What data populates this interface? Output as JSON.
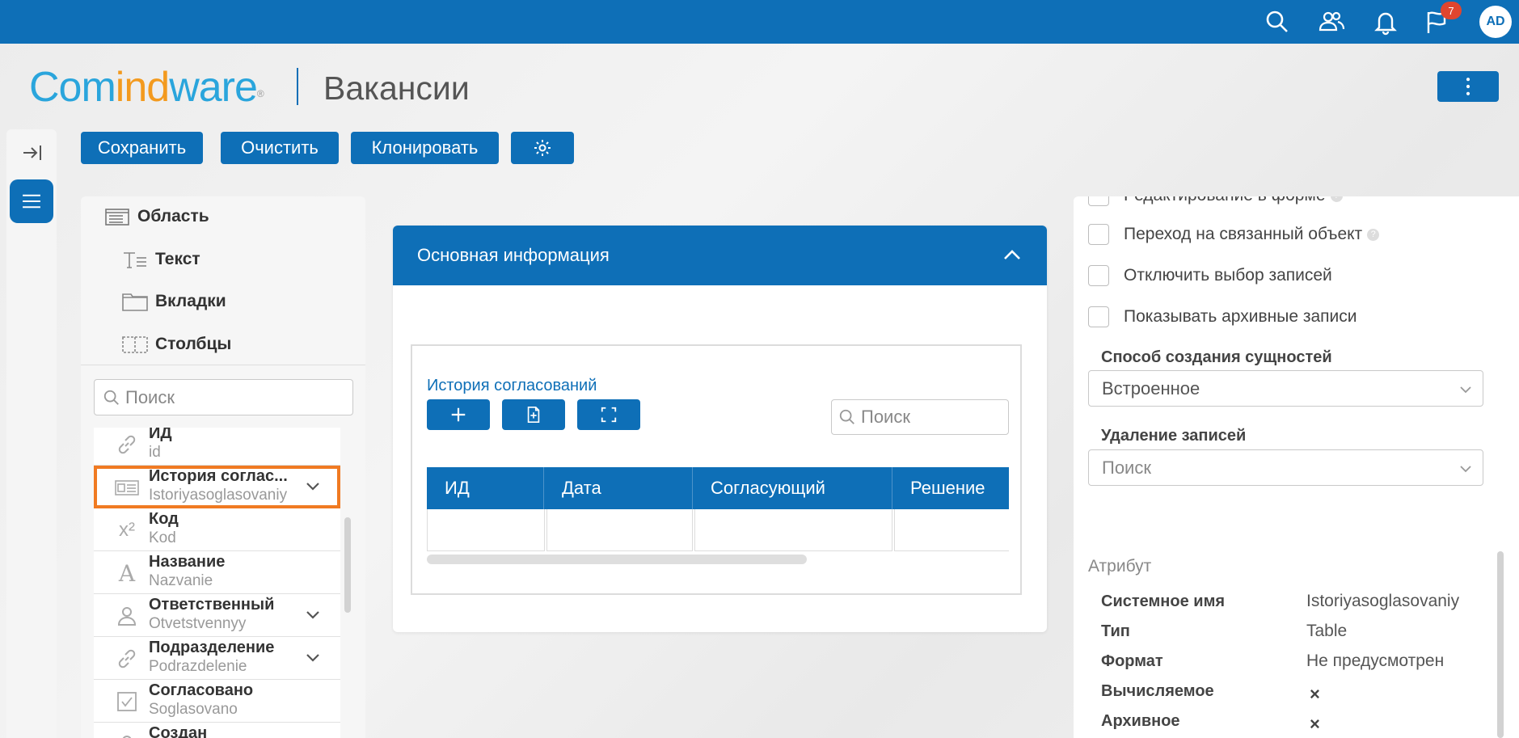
{
  "topbar": {
    "notification_count": "7",
    "avatar_initials": "AD",
    "icons": [
      "search-icon",
      "users-icon",
      "bell-icon",
      "flag-icon"
    ]
  },
  "header": {
    "logo_part1": "Com",
    "logo_part2": "ind",
    "logo_part3": "ware",
    "logo_reg": "®",
    "page_title": "Вакансии"
  },
  "toolbar": {
    "save_label": "Сохранить",
    "clear_label": "Очистить",
    "clone_label": "Клонировать"
  },
  "left_panel": {
    "elements": [
      {
        "label": "Область",
        "icon": "area-icon"
      },
      {
        "label": "Текст",
        "icon": "text-icon"
      },
      {
        "label": "Вкладки",
        "icon": "tabs-icon"
      },
      {
        "label": "Столбцы",
        "icon": "columns-icon"
      }
    ],
    "search_placeholder": "Поиск",
    "attributes": [
      {
        "name": "ИД",
        "system_name": "id",
        "icon": "link-icon",
        "expandable": false
      },
      {
        "name": "История соглас...",
        "system_name": "Istoriyasoglasovaniy",
        "icon": "table-icon",
        "expandable": true,
        "selected": true
      },
      {
        "name": "Код",
        "system_name": "Kod",
        "icon": "number-icon",
        "expandable": false
      },
      {
        "name": "Название",
        "system_name": "Nazvanie",
        "icon": "text-type-icon",
        "expandable": false
      },
      {
        "name": "Ответственный",
        "system_name": "Otvetstvennyy",
        "icon": "user-icon",
        "expandable": true
      },
      {
        "name": "Подразделение",
        "system_name": "Podrazdelenie",
        "icon": "link-icon",
        "expandable": true
      },
      {
        "name": "Согласовано",
        "system_name": "Soglasovano",
        "icon": "checkbox-icon",
        "expandable": false
      },
      {
        "name": "Создан",
        "system_name": "",
        "icon": "user-icon",
        "expandable": false
      }
    ]
  },
  "form": {
    "section_title": "Основная информация",
    "subform_title": "История согласований",
    "search_placeholder": "Поиск",
    "columns": [
      "ИД",
      "Дата",
      "Согласующий",
      "Решение"
    ]
  },
  "right_panel": {
    "checkboxes": [
      {
        "label": "Редактирование в форме",
        "help": true,
        "checked": false
      },
      {
        "label": "Переход на связанный объект",
        "help": true,
        "checked": false
      },
      {
        "label": "Отключить выбор записей",
        "help": false,
        "checked": false
      },
      {
        "label": "Показывать архивные записи",
        "help": false,
        "checked": false
      }
    ],
    "creation_label": "Способ создания сущностей",
    "creation_value": "Встроенное",
    "deletion_label": "Удаление записей",
    "deletion_placeholder": "Поиск",
    "attribute_heading": "Атрибут",
    "attr_props": [
      {
        "key": "Системное имя",
        "value": "Istoriyasoglasovaniy"
      },
      {
        "key": "Тип",
        "value": "Table"
      },
      {
        "key": "Формат",
        "value": "Не предусмотрен"
      },
      {
        "key": "Вычисляемое",
        "value": "×"
      },
      {
        "key": "Архивное",
        "value": "×"
      }
    ]
  },
  "colors": {
    "primary": "#0e6fb7",
    "logo_blue": "#2aa5dc",
    "logo_orange": "#f39a1e",
    "selection": "#f07a22",
    "badge": "#e0452f"
  }
}
